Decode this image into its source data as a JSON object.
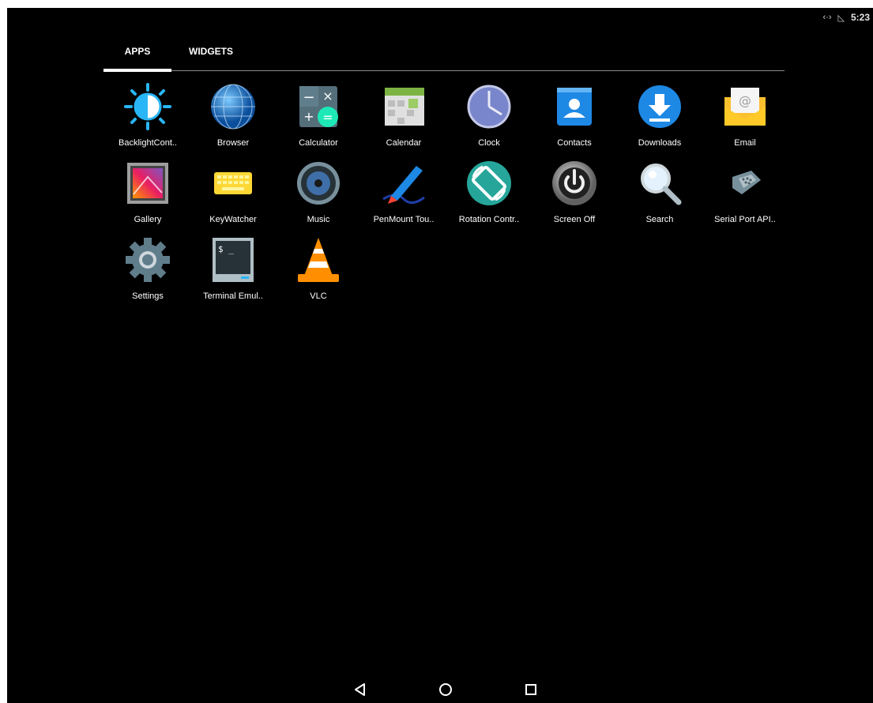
{
  "status_bar": {
    "icons": [
      "data-transfer-icon",
      "no-signal-icon"
    ],
    "time": "5:23"
  },
  "tabs": [
    {
      "label": "APPS",
      "selected": true
    },
    {
      "label": "WIDGETS",
      "selected": false
    }
  ],
  "apps": [
    {
      "label": "BacklightCont..",
      "icon": "backlight-icon"
    },
    {
      "label": "Browser",
      "icon": "browser-globe-icon"
    },
    {
      "label": "Calculator",
      "icon": "calculator-icon"
    },
    {
      "label": "Calendar",
      "icon": "calendar-icon"
    },
    {
      "label": "Clock",
      "icon": "clock-icon"
    },
    {
      "label": "Contacts",
      "icon": "contacts-icon"
    },
    {
      "label": "Downloads",
      "icon": "download-icon"
    },
    {
      "label": "Email",
      "icon": "email-icon"
    },
    {
      "label": "Gallery",
      "icon": "gallery-icon"
    },
    {
      "label": "KeyWatcher",
      "icon": "keyboard-icon"
    },
    {
      "label": "Music",
      "icon": "speaker-icon"
    },
    {
      "label": "PenMount Tou..",
      "icon": "pen-icon"
    },
    {
      "label": "Rotation Contr..",
      "icon": "rotation-icon"
    },
    {
      "label": "Screen Off",
      "icon": "power-icon"
    },
    {
      "label": "Search",
      "icon": "magnifier-icon"
    },
    {
      "label": "Serial Port API..",
      "icon": "serial-port-icon"
    },
    {
      "label": "Settings",
      "icon": "gear-icon"
    },
    {
      "label": "Terminal Emul..",
      "icon": "terminal-icon"
    },
    {
      "label": "VLC",
      "icon": "vlc-cone-icon"
    }
  ],
  "nav_bar": {
    "buttons": [
      "back-icon",
      "home-icon",
      "recents-icon"
    ]
  },
  "colors": {
    "background": "#000000",
    "text": "#ffffff",
    "accent_blue": "#1e88e5",
    "accent_cyan": "#29b6f6"
  }
}
